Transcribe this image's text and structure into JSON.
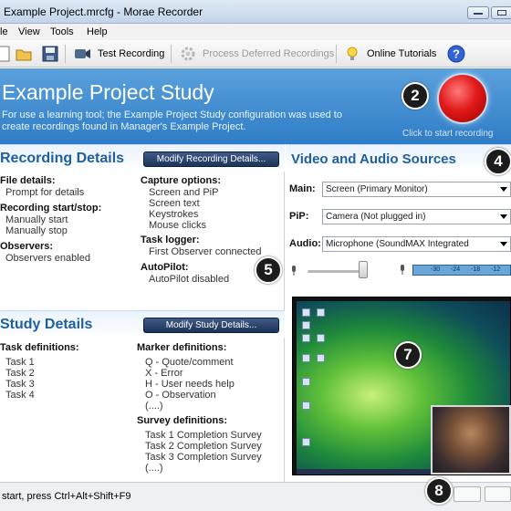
{
  "window": {
    "title": "Example Project.mrcfg - Morae Recorder"
  },
  "menu": {
    "items": [
      "le",
      "View",
      "Tools",
      "Help"
    ]
  },
  "toolbar": {
    "test_recording": "Test Recording",
    "process_deferred": "Process Deferred Recordings",
    "online_tutorials": "Online Tutorials"
  },
  "banner": {
    "title": "Example Project Study",
    "description": "For use a learning tool; the Example Project Study configuration was used to create recordings found in Manager's Example Project.",
    "record_caption": "Click to start recording"
  },
  "callouts": [
    "2",
    "4",
    "5",
    "7",
    "8"
  ],
  "recording": {
    "title": "Recording Details",
    "modify_button": "Modify Recording Details...",
    "file_details_label": "File details:",
    "file_details_value": "Prompt for details",
    "start_stop_label": "Recording start/stop:",
    "start_stop_values": [
      "Manually start",
      "Manually stop"
    ],
    "observers_label": "Observers:",
    "observers_value": "Observers enabled",
    "capture_label": "Capture options:",
    "capture_values": [
      "Screen and PiP",
      "Screen text",
      "Keystrokes",
      "Mouse clicks"
    ],
    "task_logger_label": "Task logger:",
    "task_logger_value": "First Observer connected",
    "autopilot_label": "AutoPilot:",
    "autopilot_value": "AutoPilot disabled"
  },
  "study": {
    "title": "Study Details",
    "modify_button": "Modify Study Details...",
    "task_label": "Task definitions:",
    "tasks": [
      "Task 1",
      "Task 2",
      "Task 3",
      "Task 4"
    ],
    "marker_label": "Marker definitions:",
    "markers": [
      "Q - Quote/comment",
      "X - Error",
      "H - User needs help",
      "O - Observation",
      "(....)"
    ],
    "survey_label": "Survey definitions:",
    "surveys": [
      "Task 1 Completion Survey",
      "Task 2 Completion Survey",
      "Task 3 Completion Survey",
      "(....)"
    ]
  },
  "av": {
    "title": "Video and Audio Sources",
    "main_label": "Main:",
    "main_value": "Screen (Primary Monitor)",
    "pip_label": "PiP:",
    "pip_value": "Camera (Not plugged in)",
    "audio_label": "Audio:",
    "audio_value": "Microphone (SoundMAX Integrated",
    "meter_ticks": [
      "-30",
      "-24",
      "-18",
      "-12"
    ]
  },
  "status": {
    "text": "start, press Ctrl+Alt+Shift+F9"
  }
}
